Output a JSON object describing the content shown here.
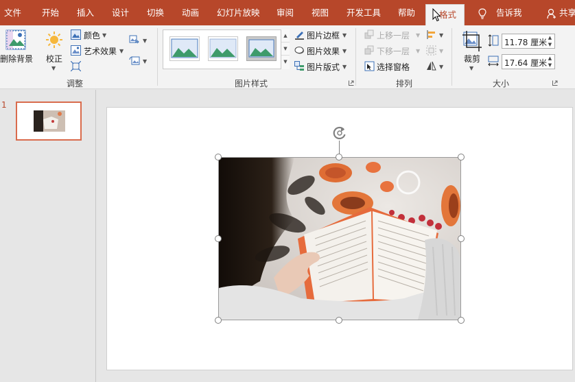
{
  "tabs": [
    {
      "label": "文件"
    },
    {
      "label": "开始"
    },
    {
      "label": "插入"
    },
    {
      "label": "设计"
    },
    {
      "label": "切换"
    },
    {
      "label": "动画"
    },
    {
      "label": "幻灯片放映"
    },
    {
      "label": "审阅"
    },
    {
      "label": "视图"
    },
    {
      "label": "开发工具"
    },
    {
      "label": "帮助"
    },
    {
      "label": "格式",
      "active": true
    }
  ],
  "tell_me": "告诉我",
  "share": "共享",
  "ribbon": {
    "adjust": {
      "remove_bg": "删除背景",
      "correct": "校正",
      "color": "颜色",
      "art_effects": "艺术效果",
      "group_label": "调整"
    },
    "picture_styles": {
      "border": "图片边框",
      "effects": "图片效果",
      "layout": "图片版式",
      "group_label": "图片样式"
    },
    "arrange": {
      "bring_forward": "上移一层",
      "send_backward": "下移一层",
      "selection_pane": "选择窗格",
      "group_label": "排列"
    },
    "size": {
      "crop": "裁剪",
      "height": "11.78 厘米",
      "width": "17.64 厘米",
      "group_label": "大小"
    }
  },
  "slides": [
    {
      "number": "1"
    }
  ],
  "colors": {
    "accent": "#b7472a",
    "thumb_border": "#d96b4c"
  },
  "icons": [
    "remove-background-icon",
    "correct-icon",
    "color-icon",
    "art-effects-icon",
    "compress-icon",
    "change-picture-icon",
    "reset-picture-icon",
    "picture-border-icon",
    "picture-effects-icon",
    "picture-layout-icon",
    "bring-forward-icon",
    "send-backward-icon",
    "selection-pane-icon",
    "align-icon",
    "group-icon",
    "rotate-icon",
    "crop-icon",
    "height-icon",
    "width-icon",
    "lightbulb-icon",
    "person-icon",
    "rotate-handle-icon"
  ]
}
